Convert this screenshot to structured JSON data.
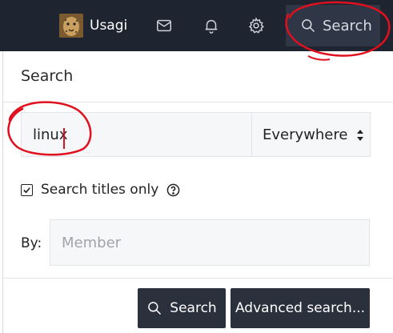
{
  "navbar": {
    "username": "Usagi",
    "avatar_icon": "cheetah-avatar",
    "icons": [
      "inbox-icon",
      "bell-icon",
      "gear-icon"
    ],
    "search_label": "Search",
    "colors": {
      "background": "#1e2430",
      "search_bg": "#2f3746",
      "icon": "#cfd4dc"
    }
  },
  "search_panel": {
    "title": "Search",
    "query_value": "linux",
    "scope": {
      "selected": "Everywhere"
    },
    "titles_only": {
      "label": "Search titles only",
      "checked": true
    },
    "by": {
      "label": "By:",
      "placeholder": "Member"
    },
    "buttons": {
      "search": "Search",
      "advanced": "Advanced search..."
    },
    "colors": {
      "button_bg": "#2a303c",
      "input_bg": "#f6f7f9",
      "annotation": "#e0101e"
    }
  }
}
